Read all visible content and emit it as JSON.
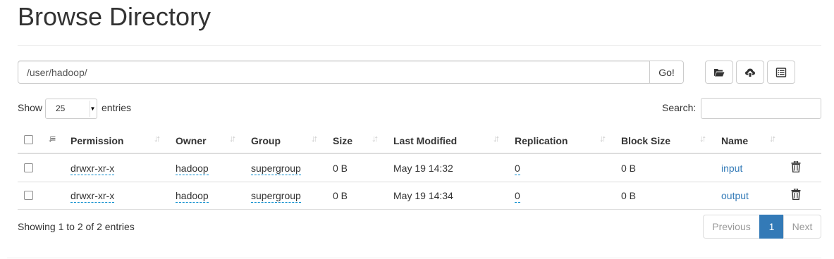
{
  "page": {
    "title": "Browse Directory"
  },
  "path_bar": {
    "value": "/user/hadoop/",
    "go_label": "Go!"
  },
  "toolbar": {
    "buttons": [
      {
        "icon": "folder-open-icon"
      },
      {
        "icon": "upload-cloud-icon"
      },
      {
        "icon": "list-alt-icon"
      }
    ]
  },
  "table_controls": {
    "show_label": "Show",
    "page_length": "25",
    "entries_label": "entries",
    "search_label": "Search:",
    "search_value": ""
  },
  "table": {
    "columns": [
      "Permission",
      "Owner",
      "Group",
      "Size",
      "Last Modified",
      "Replication",
      "Block Size",
      "Name"
    ],
    "rows": [
      {
        "permission": "drwxr-xr-x",
        "owner": "hadoop",
        "group": "supergroup",
        "size": "0 B",
        "modified": "May 19 14:32",
        "replication": "0",
        "block_size": "0 B",
        "name": "input"
      },
      {
        "permission": "drwxr-xr-x",
        "owner": "hadoop",
        "group": "supergroup",
        "size": "0 B",
        "modified": "May 19 14:34",
        "replication": "0",
        "block_size": "0 B",
        "name": "output"
      }
    ]
  },
  "footer": {
    "info": "Showing 1 to 2 of 2 entries",
    "pagination": {
      "previous": "Previous",
      "current": "1",
      "next": "Next"
    }
  },
  "colors": {
    "accent": "#337ab7",
    "border": "#dddddd",
    "dashed_link": "#0088cc"
  }
}
